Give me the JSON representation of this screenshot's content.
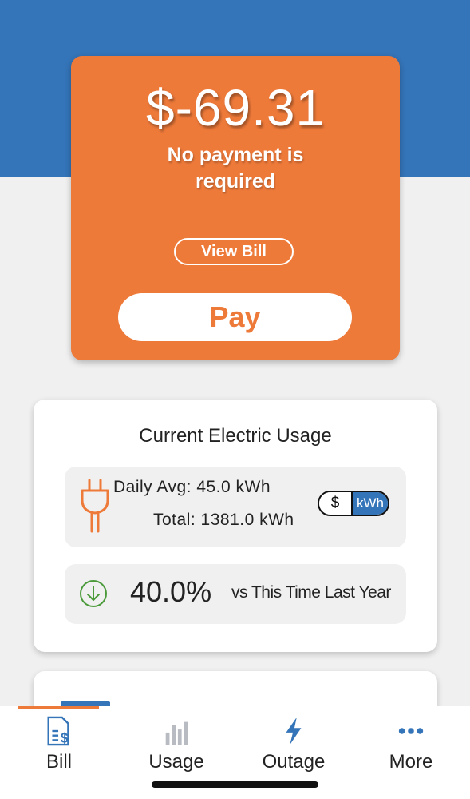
{
  "bill": {
    "amount": "$-69.31",
    "message": "No payment is required",
    "view_bill_label": "View Bill",
    "pay_label": "Pay"
  },
  "usage": {
    "title": "Current Electric Usage",
    "daily_avg": "Daily Avg: 45.0 kWh",
    "total": "Total: 1381.0 kWh",
    "toggle_dollar": "$",
    "toggle_kwh": "kWh",
    "toggle_selected": "kWh",
    "compare_percent": "40.0%",
    "compare_label": "vs This Time Last Year",
    "compare_direction": "down"
  },
  "tabs": [
    {
      "label": "Bill",
      "icon": "bill-icon",
      "active": true
    },
    {
      "label": "Usage",
      "icon": "usage-chart-icon",
      "active": false
    },
    {
      "label": "Outage",
      "icon": "lightning-icon",
      "active": false
    },
    {
      "label": "More",
      "icon": "more-dots-icon",
      "active": false
    }
  ],
  "colors": {
    "brand_blue": "#3474b8",
    "accent_orange": "#ee7a3a",
    "positive_green": "#4a9a3a"
  }
}
